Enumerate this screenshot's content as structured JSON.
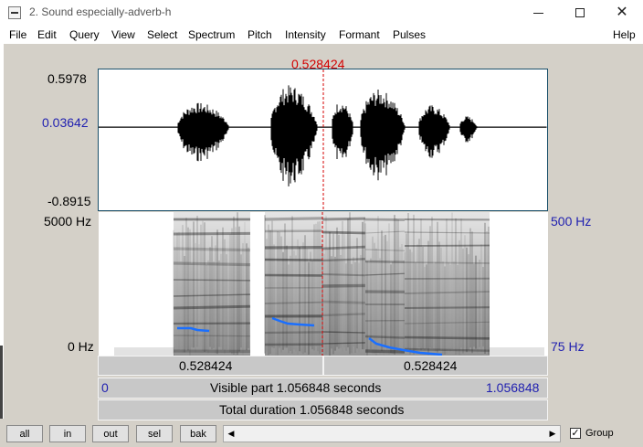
{
  "window": {
    "title": "2. Sound especially-adverb-h",
    "minimize_icon": "minimize-icon",
    "maximize_icon": "maximize-icon",
    "close_icon": "close-icon",
    "close_glyph": "✕"
  },
  "menu": [
    "File",
    "Edit",
    "Query",
    "View",
    "Select",
    "Spectrum",
    "Pitch",
    "Intensity",
    "Formant",
    "Pulses",
    "Help"
  ],
  "cursor": {
    "time": "0.528424",
    "position_fraction": 0.5
  },
  "waveform": {
    "max_label": "0.5978",
    "level_label": "0.03642",
    "min_label": "-0.8915"
  },
  "spectrogram": {
    "freq_max_label": "5000 Hz",
    "freq_min_label": "0 Hz",
    "pitch_max_label": "500 Hz",
    "pitch_min_label": "75 Hz"
  },
  "selection": {
    "left_time": "0.528424",
    "right_time": "0.528424"
  },
  "visible": {
    "start": "0",
    "label": "Visible part 1.056848 seconds",
    "end": "1.056848"
  },
  "total": {
    "label": "Total duration 1.056848 seconds"
  },
  "buttons": {
    "all": "all",
    "in": "in",
    "out": "out",
    "sel": "sel",
    "bak": "bak"
  },
  "scrollbar": {
    "left_arrow": "◀",
    "right_arrow": "▶"
  },
  "group": {
    "label": "Group",
    "checked": true,
    "check_mark": "✓"
  },
  "colors": {
    "cursor": "#d40000",
    "pitch": "#1a6fff",
    "axis_blue": "#1f1fb0"
  }
}
